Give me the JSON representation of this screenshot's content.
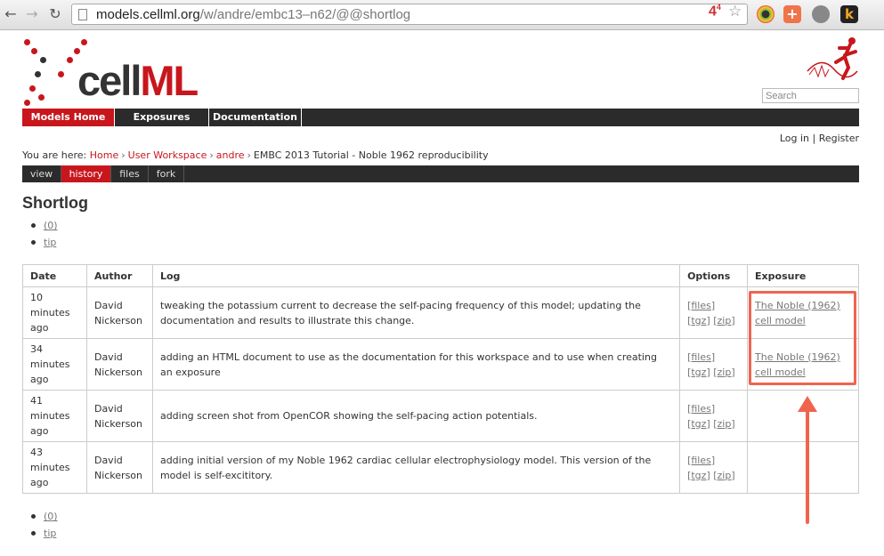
{
  "browser": {
    "url_host": "models.cellml.org",
    "url_path": "/w/andre/embc13–n62/@@shortlog",
    "extension_badge": "4",
    "extension_badge_sup": "4"
  },
  "site": {
    "logo_text_a": "cell",
    "logo_text_b": "ML",
    "search_placeholder": "Search",
    "nav": [
      "Models Home",
      "Exposures",
      "Documentation"
    ],
    "login": "Log in",
    "register": "Register"
  },
  "breadcrumb": {
    "prefix": "You are here:",
    "items": [
      "Home",
      "User Workspace",
      "andre"
    ],
    "current": "EMBC 2013 Tutorial - Noble 1962 reproducibility"
  },
  "subnav": [
    "view",
    "history",
    "files",
    "fork"
  ],
  "page_title": "Shortlog",
  "pager": {
    "prev": "(0)",
    "tip": "tip"
  },
  "table": {
    "headers": [
      "Date",
      "Author",
      "Log",
      "Options",
      "Exposure"
    ],
    "rows": [
      {
        "date": [
          "10",
          "minutes",
          "ago"
        ],
        "author": [
          "David",
          "Nickerson"
        ],
        "log": "tweaking the potassium current to decrease the self-pacing frequency of this model; updating the documentation and results to illustrate this change.",
        "options": [
          "[files]",
          "[tgz]",
          "[zip]"
        ],
        "exposure": [
          "The Noble (1962)",
          "cell model"
        ]
      },
      {
        "date": [
          "34",
          "minutes",
          "ago"
        ],
        "author": [
          "David",
          "Nickerson"
        ],
        "log": "adding an HTML document to use as the documentation for this workspace and to use when creating an exposure",
        "options": [
          "[files]",
          "[tgz]",
          "[zip]"
        ],
        "exposure": [
          "The Noble (1962)",
          "cell model"
        ]
      },
      {
        "date": [
          "41",
          "minutes",
          "ago"
        ],
        "author": [
          "David",
          "Nickerson"
        ],
        "log": "adding screen shot from OpenCOR showing the self-pacing action potentials.",
        "options": [
          "[files]",
          "[tgz]",
          "[zip]"
        ],
        "exposure": []
      },
      {
        "date": [
          "43",
          "minutes",
          "ago"
        ],
        "author": [
          "David",
          "Nickerson"
        ],
        "log": "adding initial version of my Noble 1962 cardiac cellular electrophysiology model. This version of the model is self-excititory.",
        "options": [
          "[files]",
          "[tgz]",
          "[zip]"
        ],
        "exposure": []
      }
    ]
  },
  "colors": {
    "brand_red": "#c8161d",
    "annotation": "#f0644f",
    "nav_dark": "#2b2b2b"
  }
}
